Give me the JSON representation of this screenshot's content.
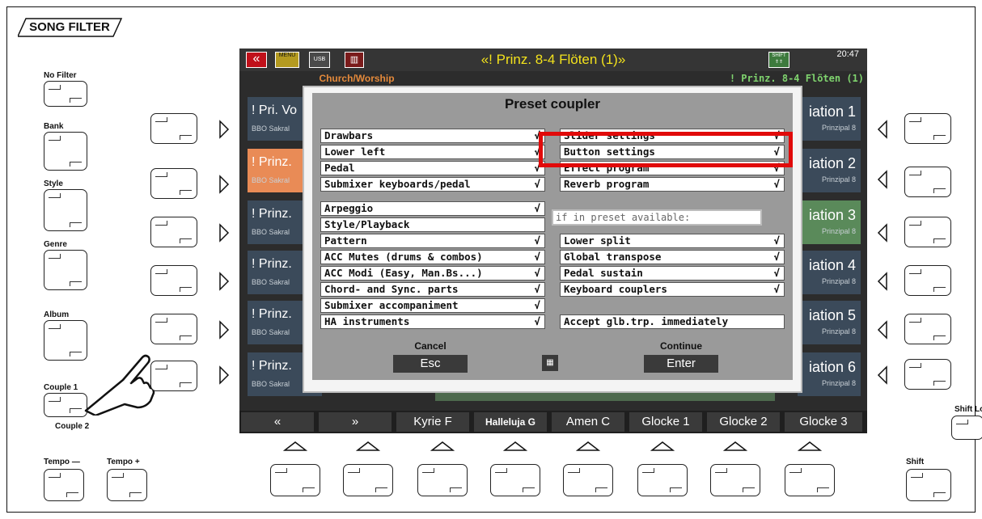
{
  "panel_title": "SONG FILTER",
  "left_buttons": {
    "no_filter": "No Filter",
    "bank": "Bank",
    "style": "Style",
    "genre": "Genre",
    "album": "Album",
    "couple1": "Couple 1",
    "couple2": "Couple 2",
    "tempo_minus": "Tempo —",
    "tempo_plus": "Tempo +"
  },
  "right_buttons": {
    "shift_lock": "Shift Lock",
    "shift": "Shift"
  },
  "screen": {
    "title": "«! Prinz. 8-4 Flöten (1)»",
    "clock": "20:47",
    "left_header": "Church/Worship",
    "right_header": "! Prinz. 8-4 Flöten (1)",
    "shift_icon_label": "SHIFT",
    "menu_icon_label": "MENU",
    "usb_icon_label": "USB",
    "left_list": [
      {
        "title": "! Pri. Vo",
        "sub": "BBO Sakral",
        "color": "#3b4a5a"
      },
      {
        "title": "! Prinz.",
        "sub": "BBO Sakral",
        "color": "#e98b56"
      },
      {
        "title": "! Prinz.",
        "sub": "BBO Sakral",
        "color": "#3b4a5a"
      },
      {
        "title": "! Prinz.",
        "sub": "BBO Sakral",
        "color": "#3b4a5a"
      },
      {
        "title": "! Prinz.",
        "sub": "BBO Sakral",
        "color": "#3b4a5a"
      },
      {
        "title": "! Prinz.",
        "sub": "BBO Sakral",
        "color": "#3b4a5a"
      }
    ],
    "right_list": [
      {
        "title": "iation 1",
        "sub": "Prinzipal    8",
        "color": "#3b4a5a"
      },
      {
        "title": "iation 2",
        "sub": "Prinzipal    8",
        "color": "#3b4a5a"
      },
      {
        "title": "iation 3",
        "sub": "Prinzipal    8",
        "color": "#5a8a5a"
      },
      {
        "title": "iation 4",
        "sub": "Prinzipal    8",
        "color": "#3b4a5a"
      },
      {
        "title": "iation 5",
        "sub": "Prinzipal    8",
        "color": "#3b4a5a"
      },
      {
        "title": "iation 6",
        "sub": "Prinzipal    8",
        "color": "#3b4a5a"
      }
    ],
    "bottom_bar": [
      "«",
      "»",
      "Kyrie F",
      "Halleluja G",
      "Amen   C",
      "Glocke 1",
      "Glocke 2",
      "Glocke 3"
    ]
  },
  "dialog": {
    "title": "Preset coupler",
    "left_group1": [
      {
        "label": "Drawbars",
        "checked": "√"
      },
      {
        "label": "Lower left",
        "checked": "√"
      },
      {
        "label": "Pedal",
        "checked": "√"
      },
      {
        "label": "Submixer keyboards/pedal",
        "checked": "√"
      }
    ],
    "left_group2": [
      {
        "label": "Arpeggio",
        "checked": "√"
      },
      {
        "label": "Style/Playback",
        "checked": ""
      },
      {
        "label": "Pattern",
        "checked": "√"
      },
      {
        "label": "ACC Mutes (drums & combos)",
        "checked": "√"
      },
      {
        "label": "ACC Modi (Easy, Man.Bs...)",
        "checked": "√"
      },
      {
        "label": "Chord- and Sync. parts",
        "checked": "√"
      },
      {
        "label": "Submixer accompaniment",
        "checked": "√"
      },
      {
        "label": "HA instruments",
        "checked": "√"
      }
    ],
    "right_group1": [
      {
        "label": "Slider settings",
        "checked": "√"
      },
      {
        "label": "Button settings",
        "checked": "√"
      },
      {
        "label": "Effect program",
        "checked": "√"
      },
      {
        "label": "Reverb program",
        "checked": "√"
      }
    ],
    "info_text": "if in preset available:",
    "right_group2": [
      {
        "label": "Lower split",
        "checked": "√"
      },
      {
        "label": "Global transpose",
        "checked": "√"
      },
      {
        "label": "Pedal sustain",
        "checked": "√"
      },
      {
        "label": "Keyboard couplers",
        "checked": "√"
      }
    ],
    "accept_label": "Accept glb.trp. immediately",
    "cancel_label": "Cancel",
    "esc_label": "Esc",
    "continue_label": "Continue",
    "enter_label": "Enter"
  },
  "accent_colors": {
    "highlight": "#e10a0a",
    "title_yellow": "#f3e21c",
    "selected": "#e98b56"
  }
}
